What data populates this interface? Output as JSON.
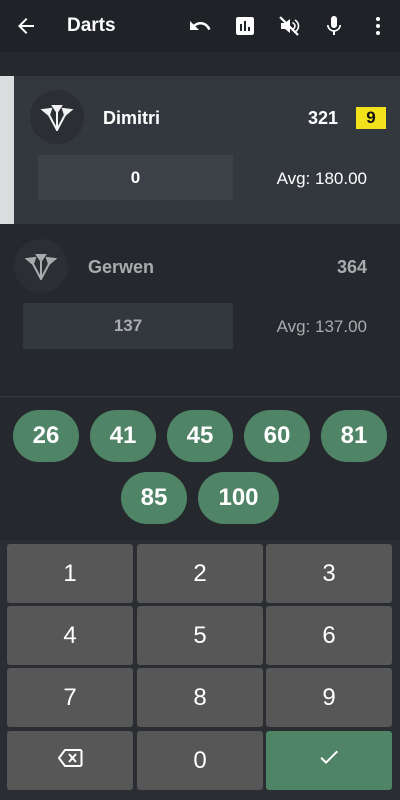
{
  "appbar": {
    "title": "Darts",
    "icons": [
      "back-arrow-icon",
      "undo-icon",
      "stats-icon",
      "speaker-off-icon",
      "microphone-icon",
      "more-vert-icon"
    ]
  },
  "players": [
    {
      "name": "Dimitri",
      "score": "321",
      "darts_badge": "9",
      "current_input": "0",
      "average": "Avg: 180.00",
      "active": true
    },
    {
      "name": "Gerwen",
      "score": "364",
      "current_input": "137",
      "average": "Avg: 137.00",
      "active": false
    }
  ],
  "quick_scores": [
    "26",
    "41",
    "45",
    "60",
    "81",
    "85",
    "100"
  ],
  "keypad": {
    "keys": [
      "1",
      "2",
      "3",
      "4",
      "5",
      "6",
      "7",
      "8",
      "9",
      "0"
    ],
    "backspace_icon": "backspace-icon",
    "confirm_icon": "check-icon"
  },
  "colors": {
    "background": "#25282d",
    "appbar": "#1f2226",
    "active_panel": "#33373e",
    "chip": "#4f8566",
    "key": "#575757",
    "badge": "#f3e11b"
  }
}
